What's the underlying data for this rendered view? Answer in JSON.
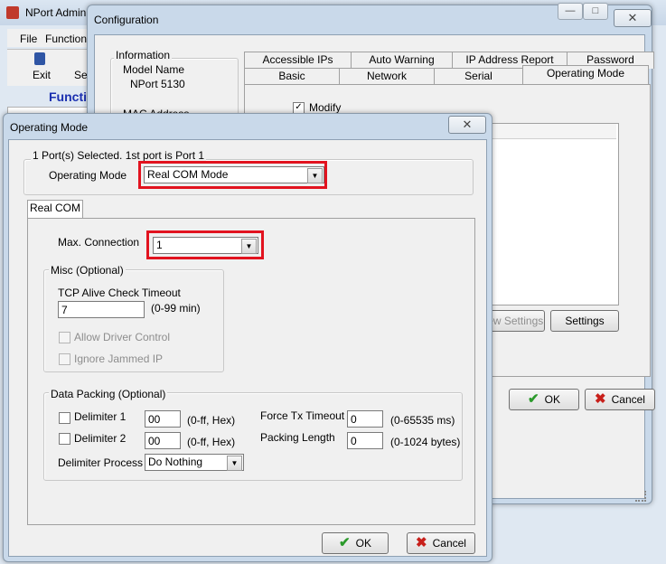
{
  "nport": {
    "title": "NPort Admin",
    "menu": [
      "File",
      "Function"
    ],
    "toolbar": {
      "exit": "Exit",
      "second_partial": "Se"
    },
    "function_header": "Functi"
  },
  "config": {
    "title": "Configuration",
    "info_group": "Information",
    "model_label": "Model Name",
    "model_value": "NPort 5130",
    "mac_label": "MAC Address",
    "tabs_row1": [
      "Accessible IPs",
      "Auto Warning",
      "IP Address Report",
      "Password"
    ],
    "tabs_row2": [
      "Basic",
      "Network",
      "Serial",
      "Operating Mode"
    ],
    "modify_label": "Modify",
    "view_settings": "View Settings",
    "settings": "Settings",
    "ok": "OK",
    "cancel": "Cancel"
  },
  "opmode": {
    "title": "Operating Mode",
    "port_group": "1 Port(s) Selected. 1st port is Port 1",
    "mode_label": "Operating Mode",
    "mode_value": "Real COM Mode",
    "tab": "Real COM",
    "max_conn_label": "Max. Connection",
    "max_conn_value": "1",
    "misc_group": "Misc (Optional)",
    "tcp_label": "TCP Alive Check Timeout",
    "tcp_value": "7",
    "tcp_range": "(0-99 min)",
    "allow_driver": "Allow Driver Control",
    "ignore_jammed": "Ignore Jammed IP",
    "packing_group": "Data Packing (Optional)",
    "delim1_label": "Delimiter 1",
    "delim1_value": "00",
    "delim1_range": "(0-ff, Hex)",
    "delim2_label": "Delimiter 2",
    "delim2_value": "00",
    "delim2_range": "(0-ff, Hex)",
    "force_label": "Force Tx Timeout",
    "force_value": "0",
    "force_range": "(0-65535 ms)",
    "packing_label": "Packing Length",
    "packing_value": "0",
    "packing_range": "(0-1024 bytes)",
    "delim_process_label": "Delimiter Process",
    "delim_process_value": "Do Nothing",
    "ok": "OK",
    "cancel": "Cancel"
  },
  "icons": {
    "ok": "check-icon",
    "cancel": "x-icon",
    "close": "close-icon",
    "dropdown": "chevron-down-icon"
  },
  "colors": {
    "highlight": "#e2131f",
    "ok_check": "#2b9a2b",
    "cancel_x": "#c8201b",
    "function_header": "#1a2fb0"
  }
}
